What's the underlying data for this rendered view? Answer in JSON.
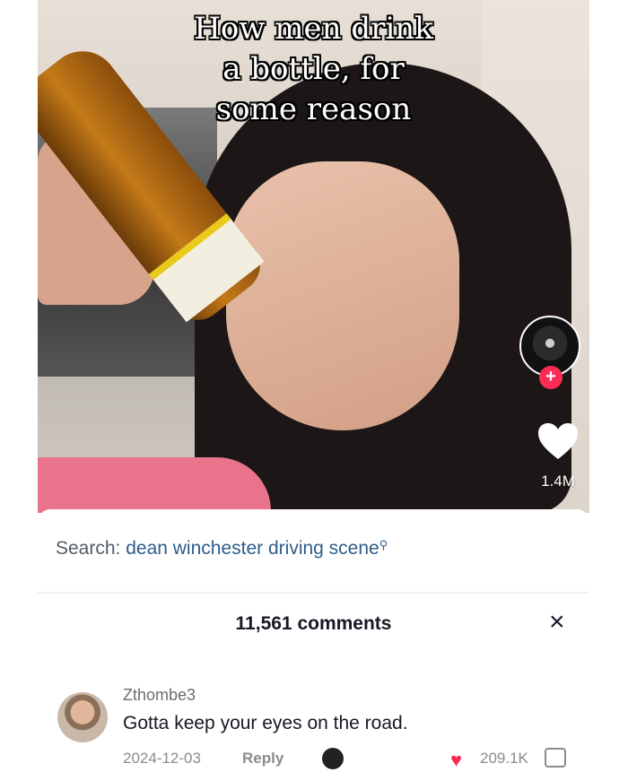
{
  "video": {
    "caption_lines": [
      "How men drink",
      "a bottle, for",
      "some reason"
    ],
    "like_count": "1.4M",
    "follow_badge": "+"
  },
  "search": {
    "prefix": "Search:",
    "term": "dean winchester driving scene"
  },
  "comments_panel": {
    "title": "11,561 comments",
    "close_glyph": "×"
  },
  "comment": {
    "username": "Zthombe3",
    "text": "Gotta keep your eyes on the road.",
    "date": "2024-12-03",
    "reply_label": "Reply",
    "like_count": "209.1K"
  },
  "icons": [
    "heart-icon",
    "plus-icon",
    "search-icon",
    "close-icon",
    "dislike-icon"
  ],
  "colors": {
    "accent": "#fe2c55",
    "search_term": "#2f5d8a",
    "text": "#161823"
  }
}
